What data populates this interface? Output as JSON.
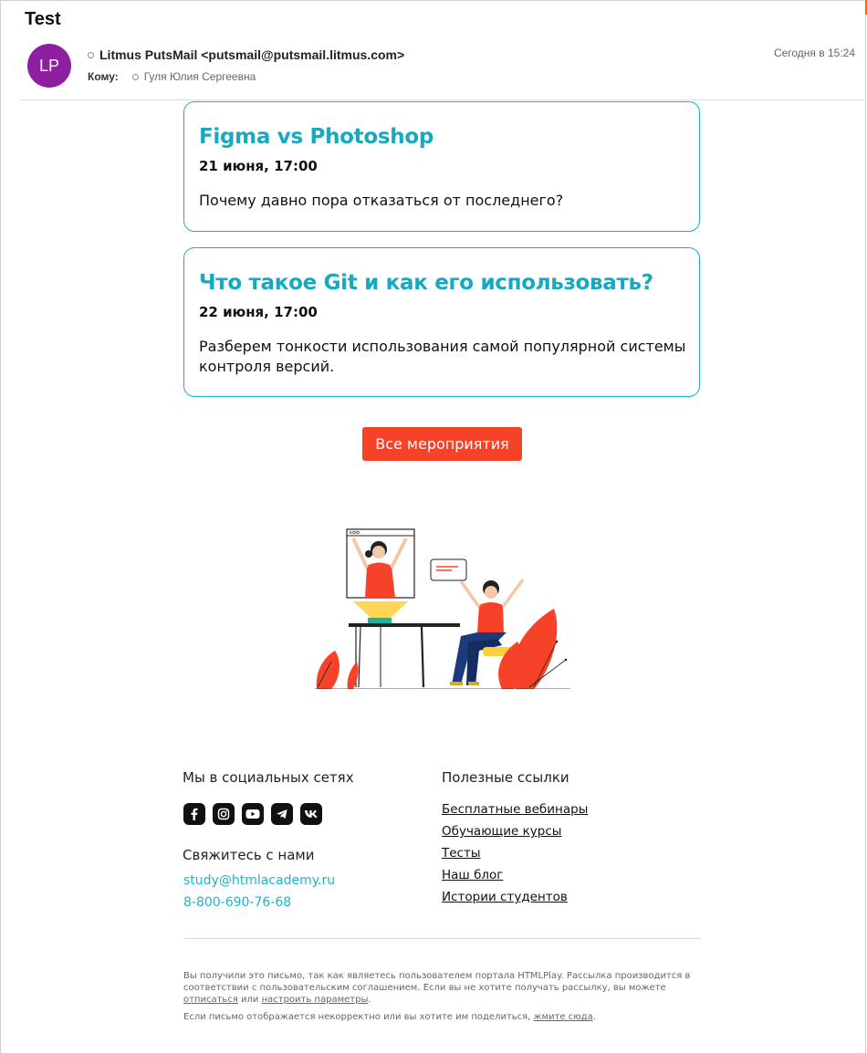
{
  "email": {
    "subject": "Test",
    "avatar_initials": "LP",
    "sender": "Litmus PutsMail <putsmail@putsmail.litmus.com>",
    "to_label": "Кому:",
    "to_name": "Гуля Юлия Сергеевна",
    "date": "Сегодня в 15:24"
  },
  "events": [
    {
      "title": "Figma vs Photoshop",
      "date": "21 июня, 17:00",
      "description": "Почему давно пора отказаться от последнего?"
    },
    {
      "title": "Что такое Git и как его использовать?",
      "date": "22 июня, 17:00",
      "description": "Разберем тонкости использования самой популярной системы контроля версий."
    }
  ],
  "cta": {
    "label": "Все мероприятия"
  },
  "footer": {
    "social_heading": "Мы в социальных сетях",
    "social_icons": [
      "facebook-icon",
      "instagram-icon",
      "youtube-icon",
      "telegram-icon",
      "vk-icon"
    ],
    "contact_heading": "Свяжитесь с нами",
    "contact_email": "study@htmlacademy.ru",
    "contact_phone": "8-800-690-76-68",
    "links_heading": "Полезные ссылки",
    "links": [
      "Бесплатные вебинары",
      "Обучающие курсы",
      "Тесты",
      "Наш блог",
      "Истории студентов"
    ],
    "legal_text_1": "Вы получили это письмо, так как являетесь пользователем портала HTMLPlay. Рассылка производится в соответствии с пользовательским соглашением. Если вы не хотите получать рассылку, вы можете ",
    "unsubscribe_link": "отписаться",
    "legal_or": " или ",
    "settings_link": "настроить параметры",
    "legal_end": ".",
    "legal_text_2": "Если письмо отображается некорректно или вы хотите им поделиться, ",
    "view_link": "жмите сюда",
    "legal_text_2_end": "."
  },
  "colors": {
    "accent": "#17a9bf",
    "button": "#f7422a",
    "avatar": "#8e1fa0"
  }
}
